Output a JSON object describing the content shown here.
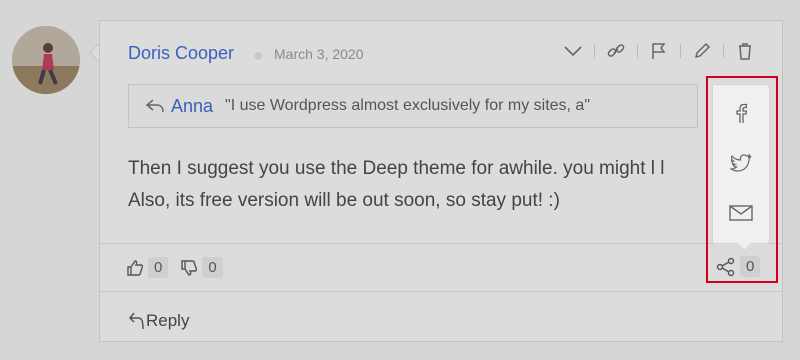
{
  "comment": {
    "author": "Doris Cooper",
    "date": "March 3, 2020",
    "quote": {
      "name": "Anna",
      "text": "\"I use Wordpress almost exclusively for my sites, a\""
    },
    "body_line1": "Then I suggest you use the Deep theme for awhile. you might l l",
    "body_line2": "Also, its free version will be out soon, so stay put! :)",
    "upvotes": "0",
    "downvotes": "0",
    "shares": "0",
    "reply_label": "Reply"
  },
  "icons": {
    "actions": [
      "chevron-down-icon",
      "link-icon",
      "flag-icon",
      "pencil-icon",
      "trash-icon"
    ],
    "share": [
      "facebook-icon",
      "twitter-icon",
      "mail-icon"
    ]
  },
  "colors": {
    "author": "#3a5fbd",
    "highlight": "#d0021b"
  }
}
